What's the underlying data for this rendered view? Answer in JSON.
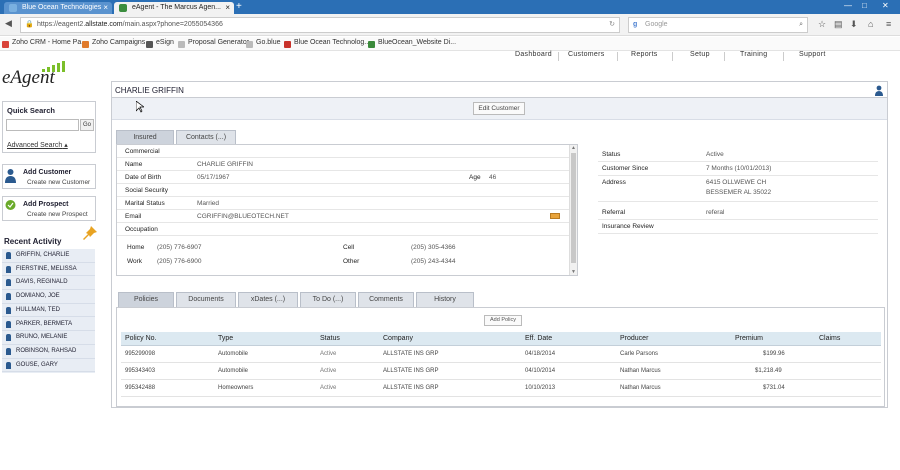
{
  "browser": {
    "tabs": [
      {
        "label": "Blue Ocean Technologies"
      },
      {
        "label": "eAgent - The Marcus Agen..."
      }
    ],
    "url_prefix": "https://eagent2.",
    "url_domain": "allstate.com",
    "url_path": "/main.aspx?phone=2055054366",
    "search_placeholder": "Google",
    "bookmarks": [
      "Zoho CRM - Home Pa...",
      "Zoho Campaigns",
      "eSign",
      "Proposal Generator",
      "Go.blue",
      "Blue Ocean Technolog...",
      "BlueOcean_Website Di..."
    ]
  },
  "app": {
    "logo": "eAgent",
    "nav": [
      "Dashboard",
      "Customers",
      "Reports",
      "Setup",
      "Training",
      "Support"
    ]
  },
  "sidebar": {
    "quick_search_title": "Quick Search",
    "go_label": "Go",
    "advanced_search": "Advanced Search",
    "add_customer_title": "Add Customer",
    "add_customer_sub": "Create new Customer",
    "add_prospect_title": "Add Prospect",
    "add_prospect_sub": "Create new Prospect",
    "recent_title": "Recent Activity",
    "recent": [
      "GRIFFIN, CHARLIE",
      "FIERSTINE, MELISSA",
      "DAVIS, REGINALD",
      "DOMIANO, JOE",
      "HULLMAN, TED",
      "PARKER, BERMETA",
      "BRUNO, MELANIE",
      "ROBINSON, RAHSAD",
      "GOUSE, GARY"
    ]
  },
  "customer": {
    "name": "CHARLIE GRIFFIN",
    "edit_button": "Edit Customer",
    "tabs": [
      "Insured",
      "Contacts (...)"
    ],
    "section_commercial": "Commercial",
    "name_label": "Name",
    "name_value": "CHARLIE GRIFFIN",
    "dob_label": "Date of Birth",
    "dob_value": "05/17/1967",
    "age_label": "Age",
    "age_value": "46",
    "ssn_label": "Social Security",
    "marital_label": "Marital Status",
    "marital_value": "Married",
    "email_label": "Email",
    "email_value": "CGRIFFIN@BLUEOTECH.NET",
    "occupation_label": "Occupation",
    "home_label": "Home",
    "home_value": "(205) 776-6907",
    "work_label": "Work",
    "work_value": "(205) 776-6900",
    "cell_label": "Cell",
    "cell_value": "(205) 305-4366",
    "other_label": "Other",
    "other_value": "(205) 243-4344"
  },
  "status_panel": {
    "status_label": "Status",
    "status_value": "Active",
    "since_label": "Customer Since",
    "since_value": "7 Months (10/01/2013)",
    "address_label": "Address",
    "address_line1": "6415 OLLWEWE CH",
    "address_line2": "BESSEMER AL 35022",
    "referral_label": "Referral",
    "referral_value": "referal",
    "review_label": "Insurance Review"
  },
  "policies": {
    "tabs": [
      "Policies",
      "Documents",
      "xDates (...)",
      "To Do (...)",
      "Comments",
      "History"
    ],
    "add_button": "Add Policy",
    "columns": [
      "Policy No.",
      "Type",
      "Status",
      "Company",
      "Eff. Date",
      "Producer",
      "Premium",
      "Claims"
    ],
    "rows": [
      [
        "995299098",
        "Automobile",
        "Active",
        "ALLSTATE INS GRP",
        "04/18/2014",
        "Carle Parsons",
        "$199.96",
        ""
      ],
      [
        "995343403",
        "Automobile",
        "Active",
        "ALLSTATE INS GRP",
        "04/10/2014",
        "Nathan Marcus",
        "$1,218.49",
        ""
      ],
      [
        "995342488",
        "Homeowners",
        "Active",
        "ALLSTATE INS GRP",
        "10/10/2013",
        "Nathan Marcus",
        "$731.04",
        ""
      ]
    ]
  },
  "colors": {
    "accent": "#2b6fb5",
    "logo_green": "#7bbf2a",
    "table_header": "#dce9f1"
  }
}
